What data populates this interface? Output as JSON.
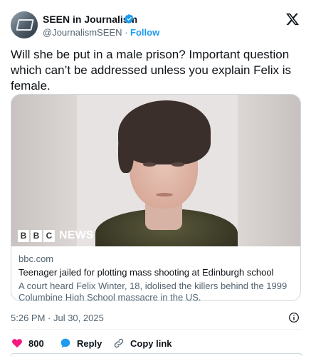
{
  "header": {
    "display_name": "SEEN in Journalism",
    "handle": "@JournalismSEEN",
    "separator": "·",
    "follow_label": "Follow",
    "verified_icon": "verified-badge-icon",
    "platform_icon": "x-logo-icon"
  },
  "tweet": {
    "text": "Will she be put in a male prison? Important question which can’t be addressed unless you explain Felix is female."
  },
  "card": {
    "image_badge": "BBC NEWS",
    "domain": "bbc.com",
    "title": "Teenager jailed for plotting mass shooting at Edinburgh school",
    "description": "A court heard Felix Winter, 18, idolised the killers behind the 1999 Columbine High School massacre in the US."
  },
  "meta": {
    "timestamp": "5:26 PM · Jul 30, 2025"
  },
  "actions": {
    "like_count": "800",
    "reply_label": "Reply",
    "copy_link_label": "Copy link"
  },
  "colors": {
    "accent": "#1d9bf0",
    "like": "#f91880",
    "muted_text": "#536471"
  }
}
